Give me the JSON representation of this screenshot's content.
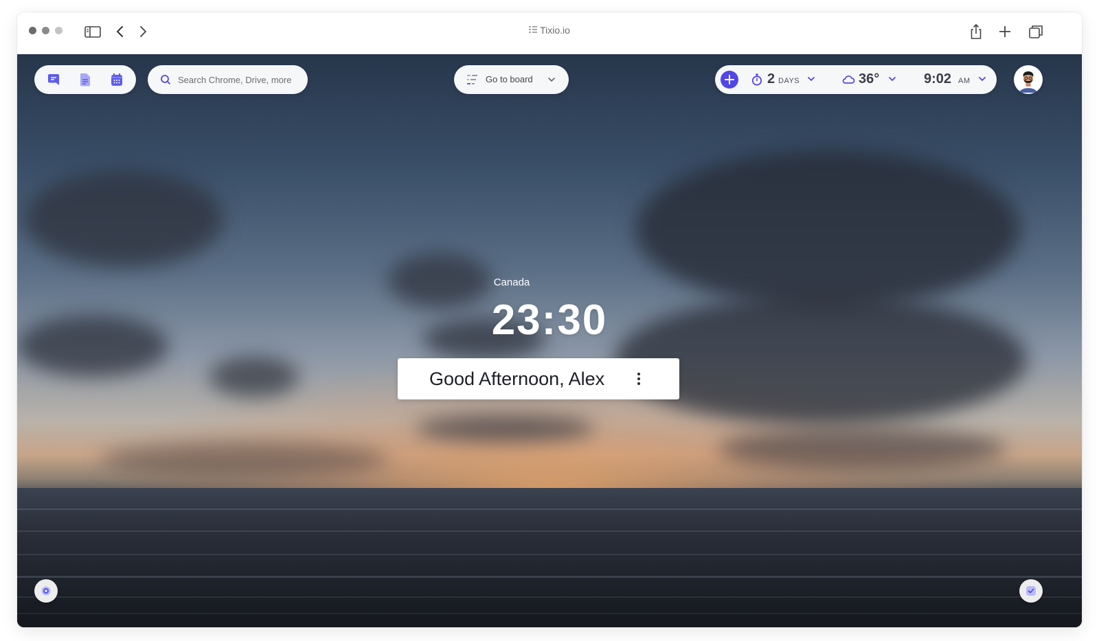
{
  "browser": {
    "url": "Tixio.io",
    "icons": [
      "sidebar-toggle-icon",
      "back-arrow-icon",
      "forward-arrow-icon",
      "share-icon",
      "new-tab-icon",
      "tabs-overview-icon"
    ]
  },
  "quick_links": [
    "chat-icon",
    "document-icon",
    "calendar-icon"
  ],
  "search": {
    "placeholder": "Search Chrome, Drive, more"
  },
  "board": {
    "label": "Go to board"
  },
  "widgets": {
    "countdown_value": "2",
    "countdown_unit": "DAYS",
    "temperature": "36°",
    "time": "9:02",
    "time_period": "AM"
  },
  "hero": {
    "location": "Canada",
    "clock": "23:30",
    "greeting": "Good Afternoon, Alex"
  },
  "colors": {
    "accent": "#5146e6",
    "quick_icon": "#5b5bf0"
  }
}
